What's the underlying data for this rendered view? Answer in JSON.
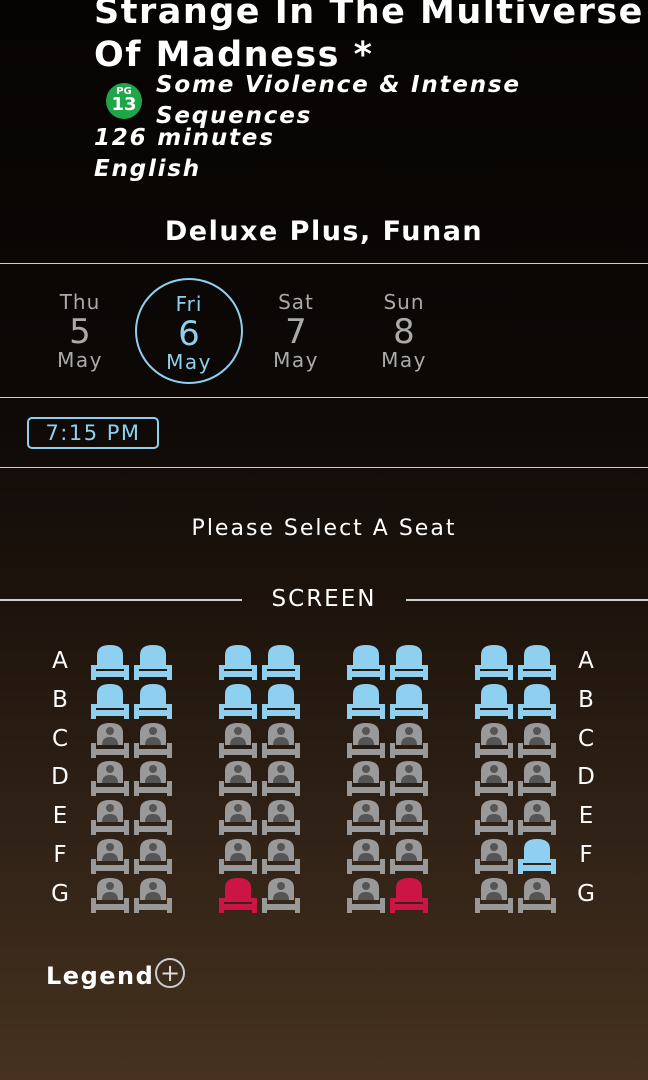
{
  "movie": {
    "title_line1": "Strange In The Multiverse",
    "title_line2": "Of Madness *",
    "rating": {
      "label": "PG",
      "number": "13",
      "color": "#1fa648"
    },
    "advisory_line1": "Some Violence & Intense",
    "advisory_line2": "Sequences",
    "duration": "126 minutes",
    "language": "English"
  },
  "venue": "Deluxe Plus, Funan",
  "dates": [
    {
      "dow": "Thu",
      "day": "5",
      "month": "May",
      "selected": false
    },
    {
      "dow": "Fri",
      "day": "6",
      "month": "May",
      "selected": true
    },
    {
      "dow": "Sat",
      "day": "7",
      "month": "May",
      "selected": false
    },
    {
      "dow": "Sun",
      "day": "8",
      "month": "May",
      "selected": false
    }
  ],
  "showtime": "7:15 PM",
  "prompt": "Please Select A Seat",
  "screen_label": "SCREEN",
  "rows": [
    "A",
    "B",
    "C",
    "D",
    "E",
    "F",
    "G"
  ],
  "seat_status_legend": {
    "a": "available",
    "o": "occupied",
    "s": "selected"
  },
  "seat_map": [
    "aaaaaaaa",
    "aaaaaaaa",
    "oooooooo",
    "oooooooo",
    "oooooooo",
    "ooooooos",
    "oossssssoo"
  ],
  "seat_grid": [
    [
      "a",
      "a",
      "a",
      "a",
      "a",
      "a",
      "a",
      "a"
    ],
    [
      "a",
      "a",
      "a",
      "a",
      "a",
      "a",
      "a",
      "a"
    ],
    [
      "o",
      "o",
      "o",
      "o",
      "o",
      "o",
      "o",
      "o"
    ],
    [
      "o",
      "o",
      "o",
      "o",
      "o",
      "o",
      "o",
      "o"
    ],
    [
      "o",
      "o",
      "o",
      "o",
      "o",
      "o",
      "o",
      "o"
    ],
    [
      "o",
      "o",
      "o",
      "o",
      "o",
      "o",
      "o",
      "a"
    ],
    [
      "o",
      "o",
      "s",
      "o",
      "o",
      "s",
      "o",
      "o"
    ]
  ],
  "colors": {
    "available": "#8fd0f0",
    "occupied": "#999999",
    "selected": "#cc1445",
    "accent": "#8fd0f0"
  },
  "legend_label": "Legend",
  "legend_icon": "plus-circle-icon"
}
